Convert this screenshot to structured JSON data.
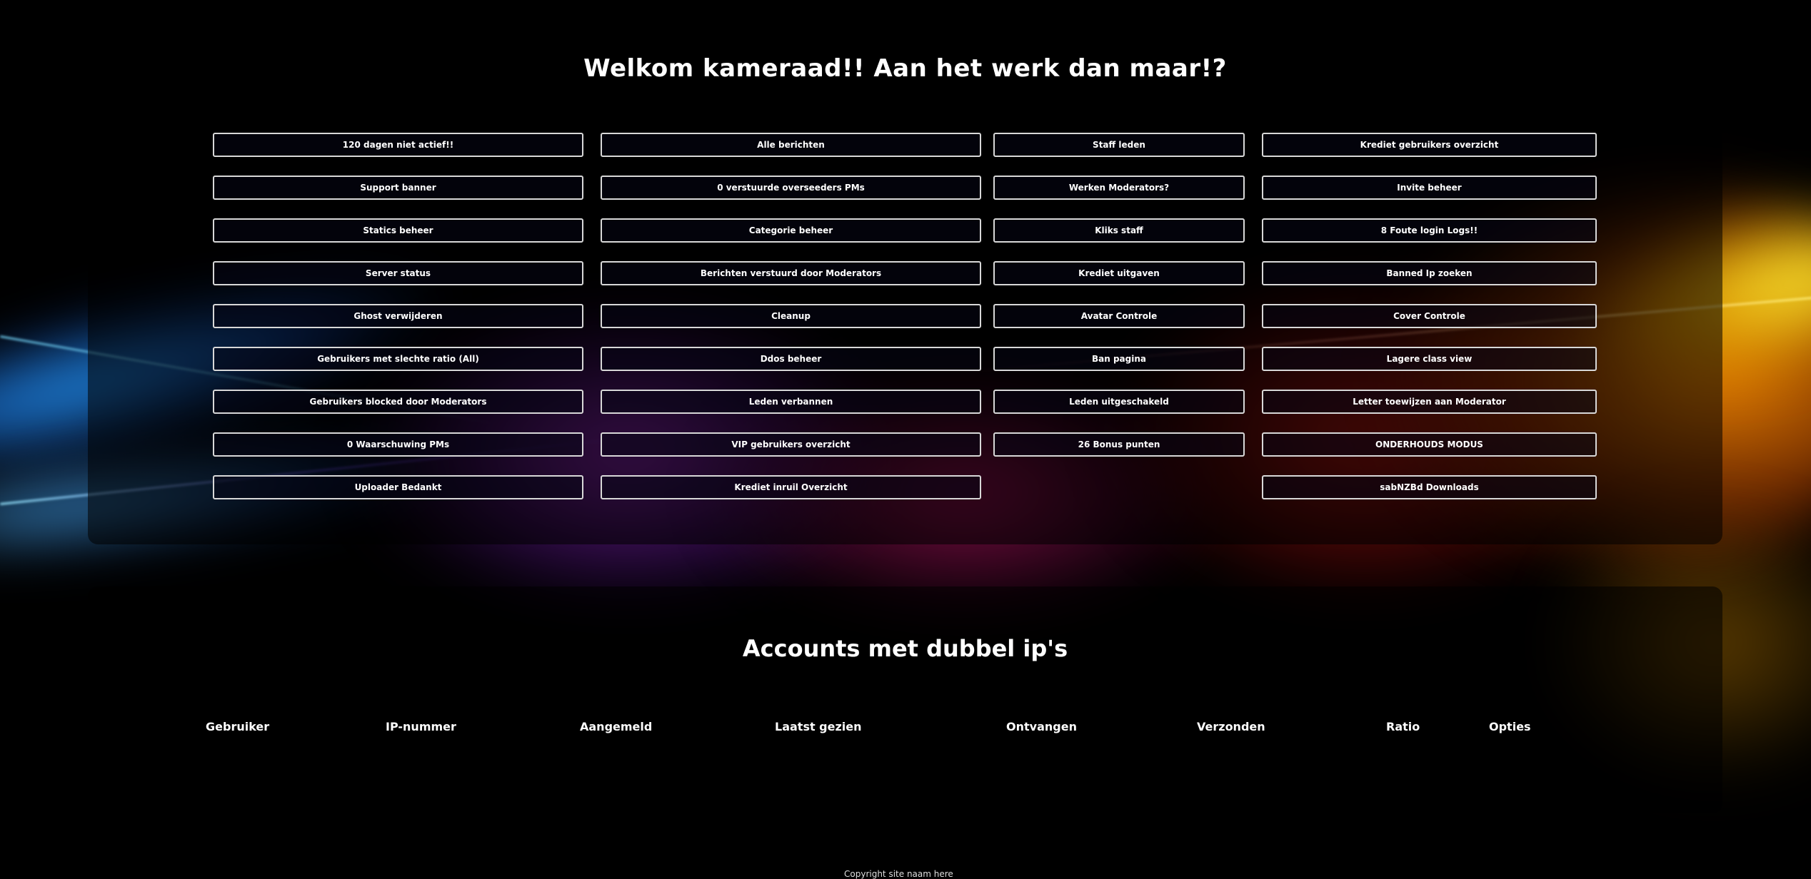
{
  "admin": {
    "title": "Welkom kameraad!! Aan het werk dan maar!?",
    "columns": [
      [
        "120 dagen niet actief!!",
        "Support banner",
        "Statics beheer",
        "Server status",
        "Ghost verwijderen",
        "Gebruikers met slechte ratio (All)",
        "Gebruikers blocked door Moderators",
        "0 Waarschuwing PMs",
        "Uploader Bedankt"
      ],
      [
        "Alle berichten",
        "0 verstuurde overseeders PMs",
        "Categorie beheer",
        "Berichten verstuurd door Moderators",
        "Cleanup",
        "Ddos beheer",
        "Leden verbannen",
        "VIP gebruikers overzicht",
        "Krediet inruil Overzicht"
      ],
      [
        "Staff  leden",
        "Werken Moderators?",
        "Kliks staff",
        "Krediet uitgaven",
        "Avatar Controle",
        "Ban pagina",
        "Leden uitgeschakeld",
        "26 Bonus punten"
      ],
      [
        "Krediet gebruikers overzicht",
        "Invite beheer",
        "8 Foute login Logs!!",
        "Banned Ip zoeken",
        "Cover Controle",
        "Lagere class view",
        "Letter toewijzen aan Moderator",
        "ONDERHOUDS MODUS",
        "sabNZBd Downloads"
      ]
    ]
  },
  "accounts": {
    "title": "Accounts met dubbel ip's",
    "headers": [
      "Gebruiker",
      "IP-nummer",
      "Aangemeld",
      "Laatst gezien",
      "Ontvangen",
      "Verzonden",
      "Ratio",
      "Opties"
    ]
  },
  "footer": {
    "text": "Copyright site naam here"
  },
  "colors": {
    "background": "#000000",
    "button_border": "#d8d8d8",
    "text": "#ffffff"
  }
}
